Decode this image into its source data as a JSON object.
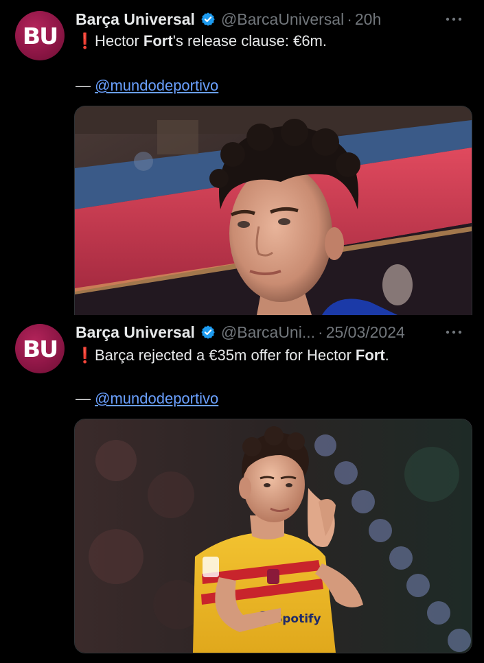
{
  "tweets": [
    {
      "avatar_text": "BU",
      "display_name": "Barça Universal",
      "handle": "@BarcaUniversal",
      "separator": "·",
      "time": "20h",
      "more_label": "•••",
      "alert_icon": "❗",
      "text_before": "Hector ",
      "text_bold": "Fort",
      "text_after": "'s release clause: €6m.",
      "source_dash": "— ",
      "source_mention": "@mundodeportivo",
      "media_alt": "Hector Fort close-up portrait in stadium"
    },
    {
      "avatar_text": "BU",
      "display_name": "Barça Universal",
      "handle": "@BarcaUni...",
      "separator": "·",
      "time": "25/03/2024",
      "more_label": "•••",
      "alert_icon": "❗",
      "text_before": "Barça rejected a €35m offer for Hector ",
      "text_bold": "Fort",
      "text_after": ".",
      "source_dash": "— ",
      "source_mention": "@mundodeportivo",
      "media_alt": "Hector Fort clapping in yellow Barça kit",
      "kit_sponsor": "Spotify"
    }
  ],
  "colors": {
    "background": "#000000",
    "text": "#e7e9ea",
    "muted": "#71767b",
    "link": "#6aa0ff",
    "verified": "#1d9bf0",
    "alert": "#e0245e",
    "avatar": "#8e1646"
  },
  "icons": {
    "verified": "verified-badge-icon",
    "more": "more-dots-icon",
    "alert": "exclamation-icon"
  }
}
